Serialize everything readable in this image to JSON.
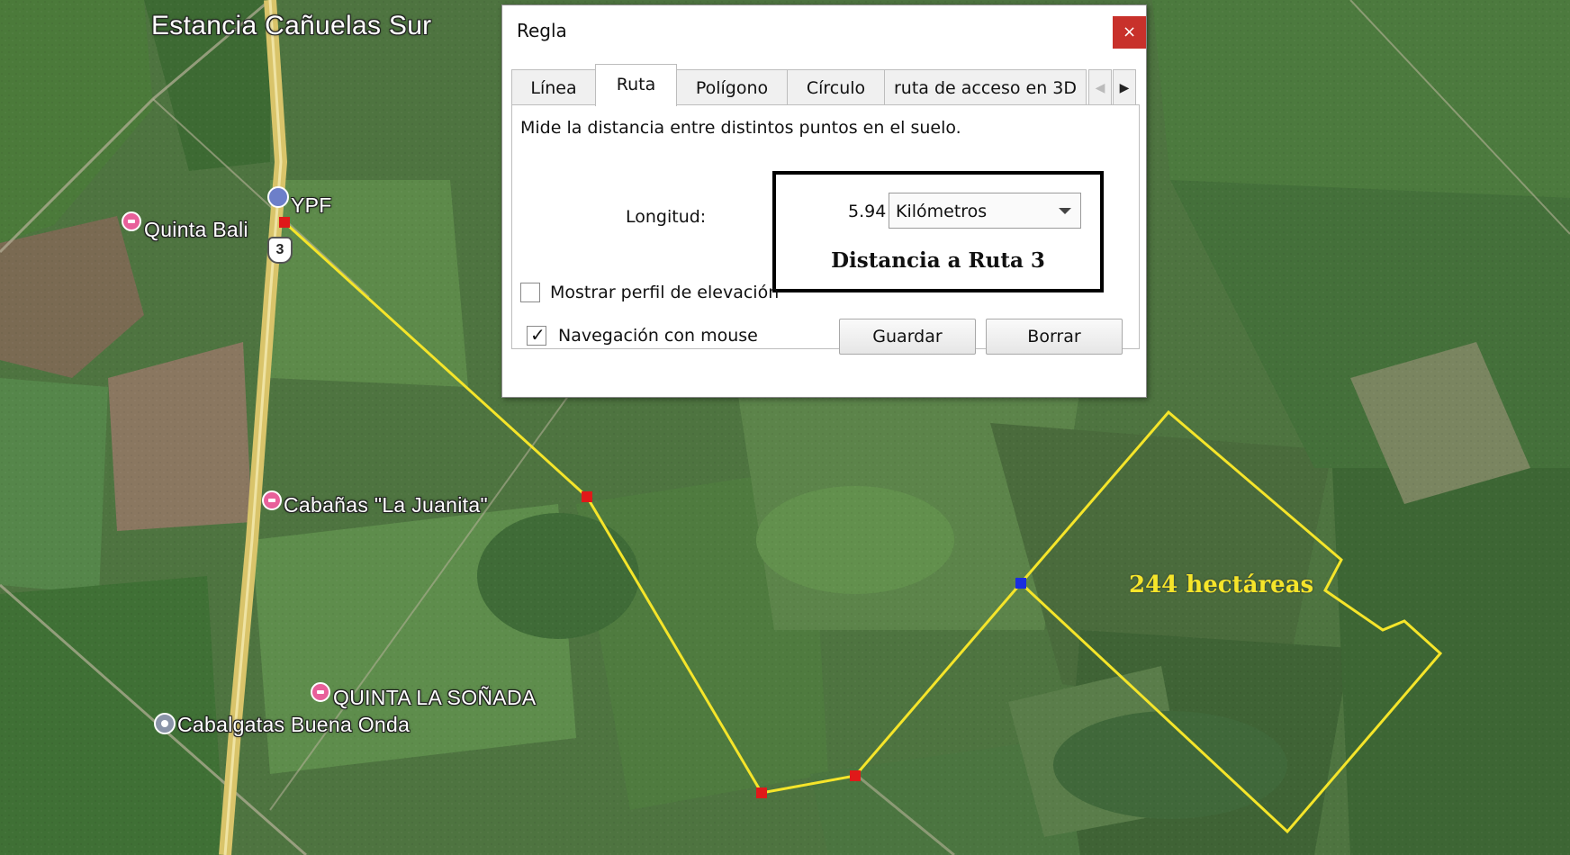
{
  "map": {
    "title": "Estancia Cañuelas Sur",
    "places": {
      "ypf": "YPF",
      "quinta_bali": "Quinta Bali",
      "route_shield": "3",
      "cabanas": "Cabañas \"La Juanita\"",
      "quinta_sonada": "QUINTA LA SOÑADA",
      "cabalgatas": "Cabalgatas Buena Onda"
    },
    "area_label": "244 hectáreas",
    "colors": {
      "path": "#f5e52a",
      "vertex": "#e01919",
      "vertex_end": "#1a2ee0"
    }
  },
  "dialog": {
    "title": "Regla",
    "close": "×",
    "tabs": [
      "Línea",
      "Ruta",
      "Polígono",
      "Círculo",
      "ruta de acceso en 3D"
    ],
    "active_tab": "Ruta",
    "description": "Mide la distancia entre distintos puntos en el suelo.",
    "length_label": "Longitud:",
    "length_value": "5.94",
    "unit": "Kilómetros",
    "annotation": "Distancia a Ruta 3",
    "elevation_label": "Mostrar perfil de elevación",
    "elevation_checked": false,
    "mouse_nav_label": "Navegación con mouse",
    "mouse_nav_checked": true,
    "save_label": "Guardar",
    "clear_label": "Borrar"
  }
}
